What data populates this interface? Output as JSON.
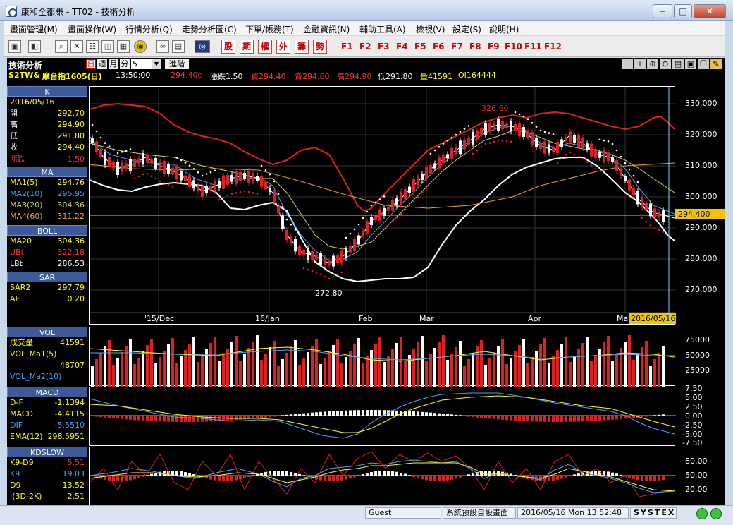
{
  "window": {
    "title": "康和全都賺 - TT02 - 技術分析",
    "controls": [
      "−",
      "□",
      "✕"
    ]
  },
  "menu": [
    "畫面管理(M)",
    "畫面操作(W)",
    "行情分析(Q)",
    "走勢分析圖(C)",
    "下單/帳務(T)",
    "金融資訊(N)",
    "輔助工具(A)",
    "檢視(V)",
    "設定(S)",
    "說明(H)"
  ],
  "toolbar": {
    "kbuttons": [
      "股",
      "期",
      "權",
      "外",
      "籌",
      "勢"
    ],
    "fkeys": [
      "F1",
      "F2",
      "F3",
      "F4",
      "F5",
      "F6",
      "F7",
      "F8",
      "F9",
      "F10",
      "F11",
      "F12"
    ]
  },
  "info": {
    "title": "技術分析",
    "periods": [
      "日",
      "週",
      "月",
      "分"
    ],
    "period_value": "5",
    "advance": "進階",
    "symbol": "S2TW&",
    "name": "摩台指1605(日)",
    "time": "13:50:00",
    "price": "294.40c",
    "change": "漲跌1.50",
    "bid": "買294.40",
    "ask": "賣294.60",
    "high": "高294.90",
    "low": "低291.80",
    "volume": "量41591",
    "oi": "OI164444"
  },
  "sidebar": {
    "k": {
      "head": "K",
      "date": "2016/05/16",
      "rows": [
        [
          "開",
          "292.70"
        ],
        [
          "高",
          "294.90"
        ],
        [
          "低",
          "291.80"
        ],
        [
          "收",
          "294.40"
        ],
        [
          "漲跌",
          "1.50"
        ]
      ]
    },
    "ma": {
      "head": "MA",
      "rows": [
        [
          "MA1(5)",
          "294.76"
        ],
        [
          "MA2(10)",
          "295.95"
        ],
        [
          "MA3(20)",
          "304.36"
        ],
        [
          "MA4(60)",
          "311.22"
        ]
      ]
    },
    "boll": {
      "head": "BOLL",
      "rows": [
        [
          "MA20",
          "304.36"
        ],
        [
          "UBt",
          "322.18"
        ],
        [
          "LBt",
          "286.53"
        ]
      ]
    },
    "sar": {
      "head": "SAR",
      "rows": [
        [
          "SAR2",
          "297.79"
        ],
        [
          "AF",
          "0.20"
        ]
      ]
    },
    "vol": {
      "head": "VOL",
      "rows": [
        [
          "成交量",
          "41591"
        ],
        [
          "VOL_Ma1(5)",
          ""
        ],
        [
          "",
          "48707"
        ],
        [
          "VOL_Ma2(10)",
          ""
        ]
      ]
    },
    "macd": {
      "head": "MACD",
      "rows": [
        [
          "D-F",
          "-1.1394"
        ],
        [
          "MACD",
          "-4.4115"
        ],
        [
          "DIF",
          "-5.5510"
        ],
        [
          "EMA(12)",
          "298.5951"
        ]
      ]
    },
    "kd": {
      "head": "KDSLOW",
      "rows": [
        [
          "K9-D9",
          "5.51"
        ],
        [
          "K9",
          "19.03"
        ],
        [
          "D9",
          "13.52"
        ],
        [
          "J(3D-2K)",
          "2.51"
        ]
      ]
    }
  },
  "chart": {
    "price_ticks": [
      "330.000",
      "320.000",
      "310.000",
      "300.000",
      "290.000",
      "280.000",
      "270.000"
    ],
    "last_price": "294.400",
    "x_labels": [
      "'15/Dec",
      "'16/Jan",
      "Feb",
      "Mar",
      "Apr",
      "Ma"
    ],
    "cursor_date": "2016/05/16",
    "high_label": "326.60",
    "low_label": "272.80",
    "vol_ticks": [
      "75000",
      "50000",
      "25000"
    ],
    "macd_ticks": [
      "7.50",
      "5.00",
      "2.50",
      "0.00",
      "-2.50",
      "-5.00",
      "-7.50"
    ],
    "kd_ticks": [
      "80.00",
      "50.00",
      "20.00"
    ]
  },
  "status": {
    "user": "Guest",
    "screen": "系統預設自設畫面",
    "datetime": "2016/05/16 Mon 13:52:48",
    "brand": "SYSTEX"
  }
}
